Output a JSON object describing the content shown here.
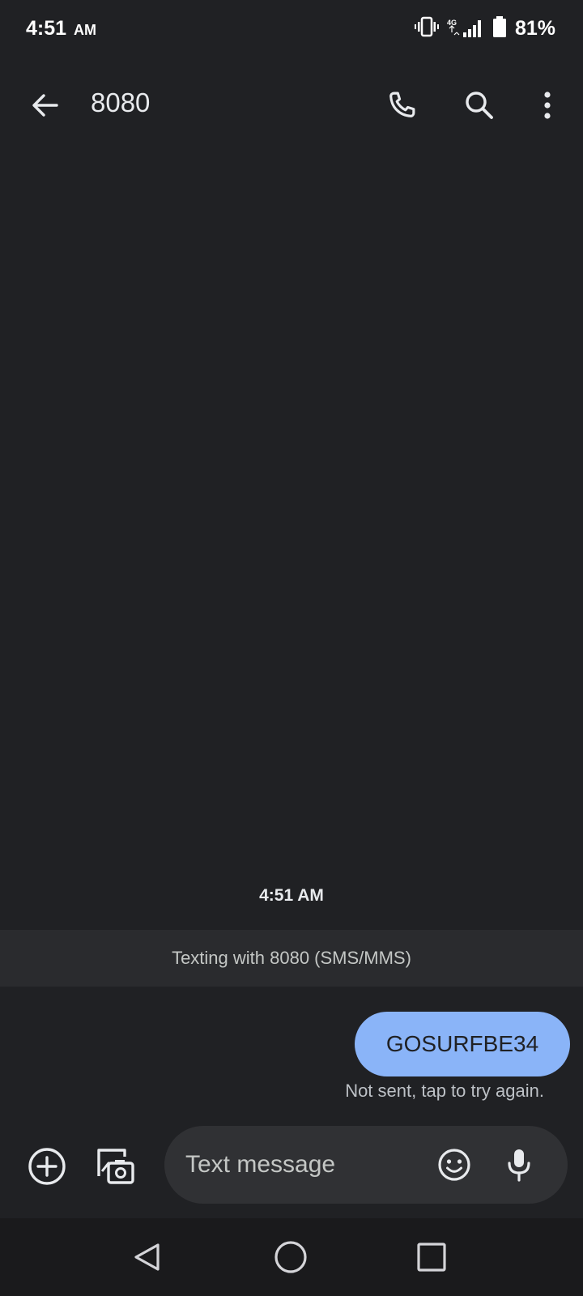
{
  "status_bar": {
    "time": "4:51",
    "ampm": "AM",
    "network": "4G",
    "battery": "81%"
  },
  "app_bar": {
    "title": "8080"
  },
  "conversation": {
    "timestamp": "4:51 AM",
    "banner": "Texting with 8080 (SMS/MMS)",
    "messages": [
      {
        "text": "GOSURFBE34",
        "status": "Not sent, tap to try again."
      }
    ]
  },
  "compose": {
    "placeholder": "Text message",
    "value": ""
  },
  "colors": {
    "background": "#202124",
    "bubble": "#8ab4f8",
    "banner": "#2a2b2e",
    "compose_field": "#303134"
  },
  "icons": {
    "back": "arrow-back-icon",
    "call": "phone-icon",
    "search": "search-icon",
    "more": "more-vert-icon",
    "add": "add-circle-icon",
    "gallery": "gallery-camera-icon",
    "emoji": "emoji-icon",
    "mic": "mic-icon"
  }
}
